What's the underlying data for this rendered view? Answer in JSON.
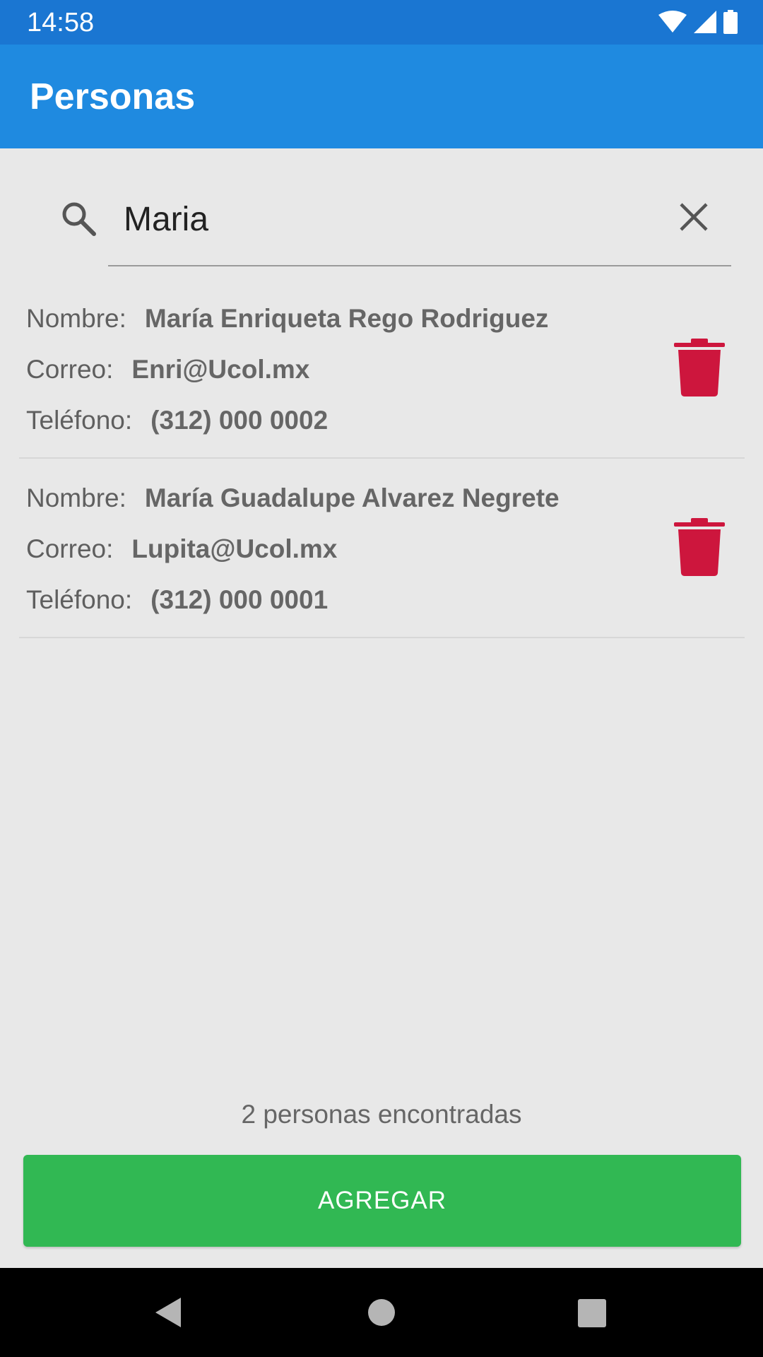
{
  "status_bar": {
    "time": "14:58",
    "icons": [
      "wifi-icon",
      "signal-icon",
      "battery-icon"
    ]
  },
  "app_bar": {
    "title": "Personas"
  },
  "search": {
    "value": "Maria",
    "icon": "search-icon",
    "clear_icon": "close-icon"
  },
  "persons": [
    {
      "nombre_label": "Nombre:",
      "nombre": "María Enriqueta Rego Rodriguez",
      "correo_label": "Correo:",
      "correo": "Enri@Ucol.mx",
      "telefono_label": "Teléfono:",
      "telefono": "(312) 000 0002",
      "delete_icon": "trash-icon"
    },
    {
      "nombre_label": "Nombre:",
      "nombre": "María Guadalupe Alvarez Negrete",
      "correo_label": "Correo:",
      "correo": "Lupita@Ucol.mx",
      "telefono_label": "Teléfono:",
      "telefono": "(312) 000 0001",
      "delete_icon": "trash-icon"
    }
  ],
  "result_count": "2 personas encontradas",
  "add_button": {
    "label": "AGREGAR"
  },
  "nav_bar": {
    "icons": [
      "back-icon",
      "home-icon",
      "recents-icon"
    ]
  },
  "colors": {
    "status_bar": "#1a76d2",
    "app_bar": "#1f8ae0",
    "background": "#e8e8e8",
    "delete": "#cd163d",
    "add_button": "#31b853"
  }
}
